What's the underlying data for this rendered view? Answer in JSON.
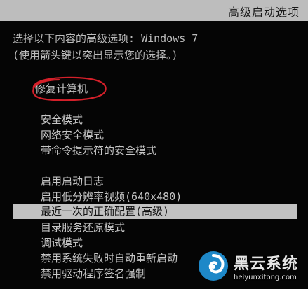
{
  "header": {
    "title": "高级启动选项"
  },
  "prompt": {
    "line1": "选择以下内容的高级选项: Windows 7",
    "line2": "(使用箭头键以突出显示您的选择。)"
  },
  "menu": {
    "repair": "修复计算机",
    "group1": [
      "安全模式",
      "网络安全模式",
      "带命令提示符的安全模式"
    ],
    "group2": [
      "启用启动日志",
      "启用低分辨率视频(640x480)",
      "最近一次的正确配置(高级)",
      "目录服务还原模式",
      "调试模式",
      "禁用系统失败时自动重新启动",
      "禁用驱动程序签名强制"
    ],
    "selected_item": "最近一次的正确配置(高级)"
  },
  "annotation": {
    "color": "#d4202a"
  },
  "watermark": {
    "name": "黑云系统",
    "url": "heiyunxitong.com",
    "logo_color": "#1e88c8"
  }
}
